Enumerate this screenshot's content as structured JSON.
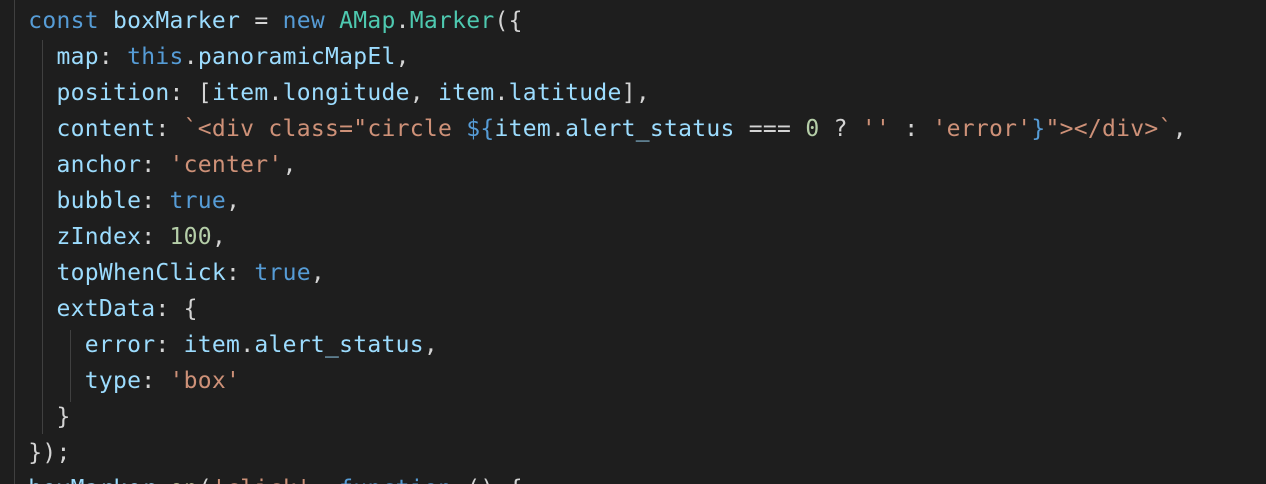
{
  "editor": {
    "theme_colors": {
      "background": "#1e1e1e",
      "keyword": "#569cd6",
      "variable": "#9cdcfe",
      "class": "#4ec9b0",
      "string": "#ce9178",
      "number": "#b5cea8",
      "text": "#d4d4d4"
    },
    "lines": [
      {
        "indent": "  ",
        "tokens": [
          {
            "text": "const",
            "kind": "kw"
          },
          {
            "text": " "
          },
          {
            "text": "boxMarker",
            "kind": "var"
          },
          {
            "text": " = "
          },
          {
            "text": "new",
            "kind": "kw"
          },
          {
            "text": " "
          },
          {
            "text": "AMap",
            "kind": "cls"
          },
          {
            "text": "."
          },
          {
            "text": "Marker",
            "kind": "cls"
          },
          {
            "text": "({"
          }
        ]
      },
      {
        "indent": "    ",
        "tokens": [
          {
            "text": "map",
            "kind": "var"
          },
          {
            "text": ": "
          },
          {
            "text": "this",
            "kind": "kw"
          },
          {
            "text": "."
          },
          {
            "text": "panoramicMapEl",
            "kind": "var"
          },
          {
            "text": ","
          }
        ]
      },
      {
        "indent": "    ",
        "tokens": [
          {
            "text": "position",
            "kind": "var"
          },
          {
            "text": ": ["
          },
          {
            "text": "item",
            "kind": "var"
          },
          {
            "text": "."
          },
          {
            "text": "longitude",
            "kind": "var"
          },
          {
            "text": ", "
          },
          {
            "text": "item",
            "kind": "var"
          },
          {
            "text": "."
          },
          {
            "text": "latitude",
            "kind": "var"
          },
          {
            "text": "],"
          }
        ]
      },
      {
        "indent": "    ",
        "tokens": [
          {
            "text": "content",
            "kind": "var"
          },
          {
            "text": ": "
          },
          {
            "text": "`<div class=\"circle ",
            "kind": "str"
          },
          {
            "text": "${",
            "kind": "tmpl"
          },
          {
            "text": "item",
            "kind": "var"
          },
          {
            "text": "."
          },
          {
            "text": "alert_status",
            "kind": "var"
          },
          {
            "text": " === "
          },
          {
            "text": "0",
            "kind": "num"
          },
          {
            "text": " ? "
          },
          {
            "text": "''",
            "kind": "str"
          },
          {
            "text": " : "
          },
          {
            "text": "'error'",
            "kind": "str"
          },
          {
            "text": "}",
            "kind": "tmpl"
          },
          {
            "text": "\"></div>`",
            "kind": "str"
          },
          {
            "text": ","
          }
        ]
      },
      {
        "indent": "    ",
        "tokens": [
          {
            "text": "anchor",
            "kind": "var"
          },
          {
            "text": ": "
          },
          {
            "text": "'center'",
            "kind": "str"
          },
          {
            "text": ","
          }
        ]
      },
      {
        "indent": "    ",
        "tokens": [
          {
            "text": "bubble",
            "kind": "var"
          },
          {
            "text": ": "
          },
          {
            "text": "true",
            "kind": "kw"
          },
          {
            "text": ","
          }
        ]
      },
      {
        "indent": "    ",
        "tokens": [
          {
            "text": "zIndex",
            "kind": "var"
          },
          {
            "text": ": "
          },
          {
            "text": "100",
            "kind": "num"
          },
          {
            "text": ","
          }
        ]
      },
      {
        "indent": "    ",
        "tokens": [
          {
            "text": "topWhenClick",
            "kind": "var"
          },
          {
            "text": ": "
          },
          {
            "text": "true",
            "kind": "kw"
          },
          {
            "text": ","
          }
        ]
      },
      {
        "indent": "    ",
        "tokens": [
          {
            "text": "extData",
            "kind": "var"
          },
          {
            "text": ": {"
          }
        ]
      },
      {
        "indent": "      ",
        "tokens": [
          {
            "text": "error",
            "kind": "var"
          },
          {
            "text": ": "
          },
          {
            "text": "item",
            "kind": "var"
          },
          {
            "text": "."
          },
          {
            "text": "alert_status",
            "kind": "var"
          },
          {
            "text": ","
          }
        ]
      },
      {
        "indent": "      ",
        "tokens": [
          {
            "text": "type",
            "kind": "var"
          },
          {
            "text": ": "
          },
          {
            "text": "'box'",
            "kind": "str"
          }
        ]
      },
      {
        "indent": "    ",
        "tokens": [
          {
            "text": "}"
          }
        ]
      },
      {
        "indent": "  ",
        "tokens": [
          {
            "text": "});"
          }
        ]
      },
      {
        "indent": "  ",
        "tokens": [
          {
            "text": "boxMarker",
            "kind": "var"
          },
          {
            "text": "."
          },
          {
            "text": "on",
            "kind": "fn"
          },
          {
            "text": "("
          },
          {
            "text": "'click'",
            "kind": "str"
          },
          {
            "text": ", "
          },
          {
            "text": "function",
            "kind": "kw"
          },
          {
            "text": " () {"
          }
        ]
      }
    ]
  }
}
